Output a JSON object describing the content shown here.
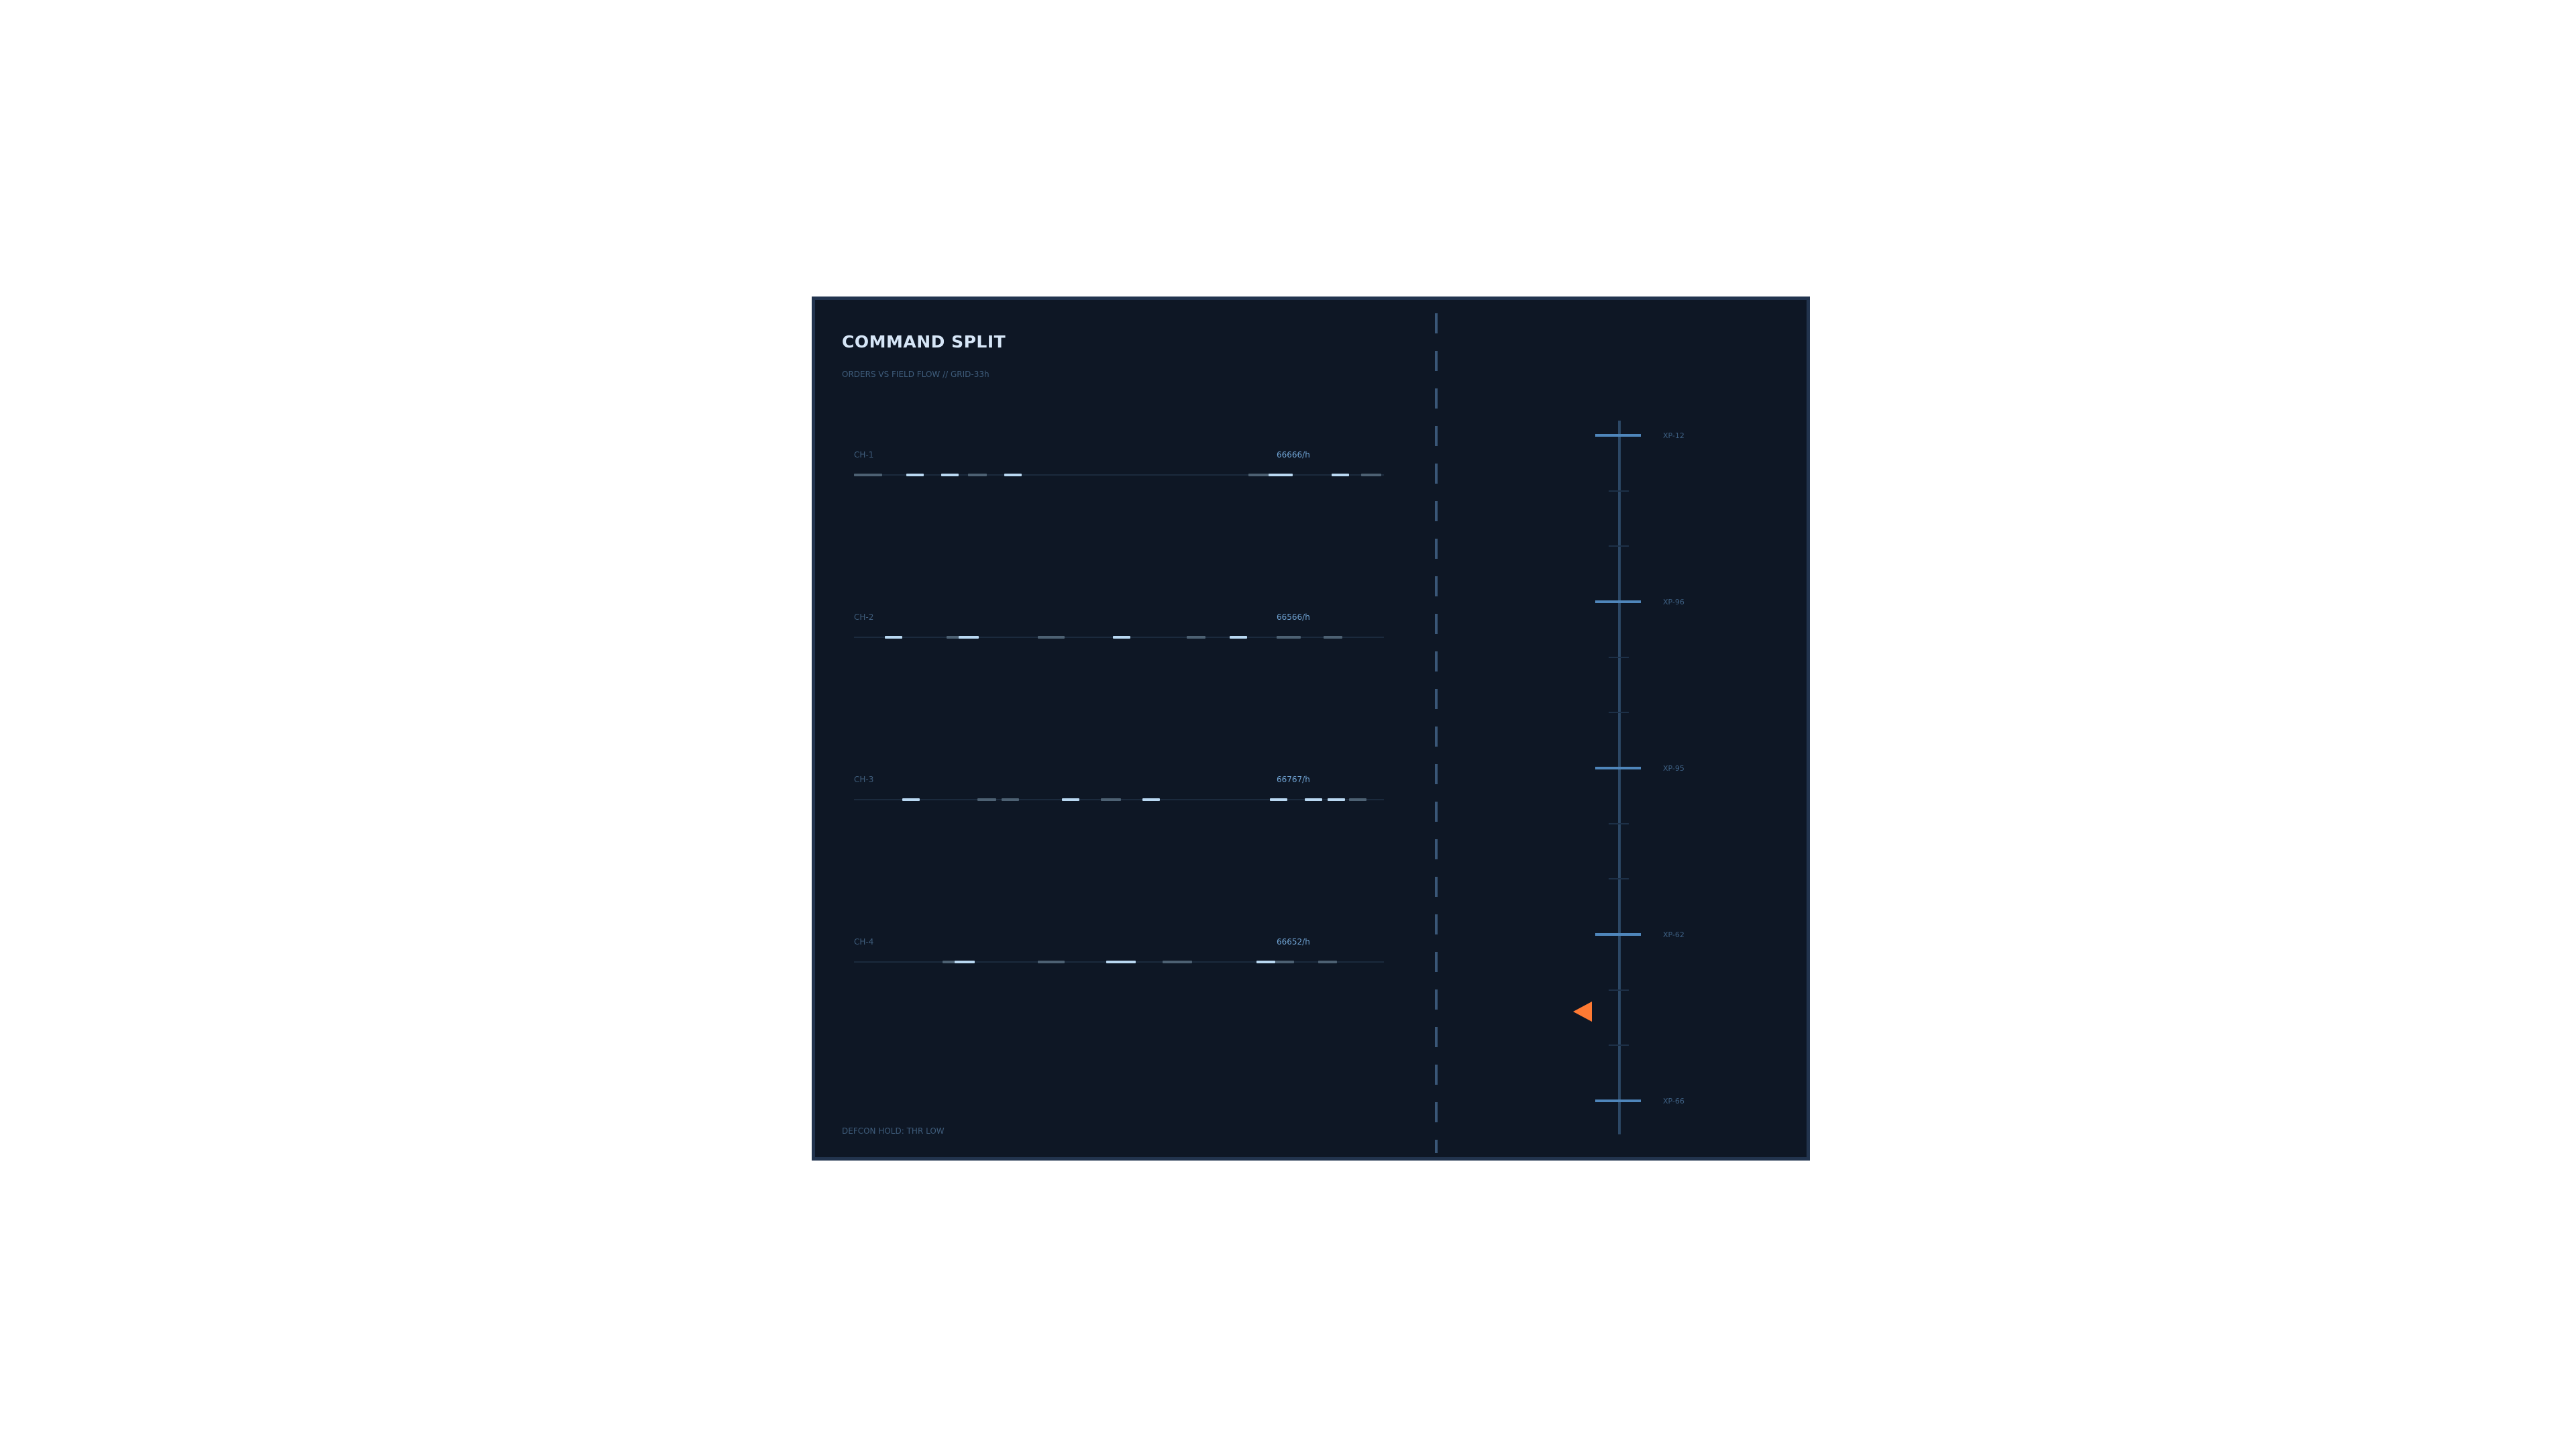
{
  "panel": {
    "title": "COMMAND SPLIT",
    "subtitle": "ORDERS VS FIELD FLOW // GRID-33h",
    "footer": "DEFCON HOLD: THR LOW",
    "accent_color": "#ff7a33",
    "background_color": "#0e1725"
  },
  "channels": [
    {
      "label": "CH-1",
      "rate": "66666/h"
    },
    {
      "label": "CH-2",
      "rate": "66566/h"
    },
    {
      "label": "CH-3",
      "rate": "66767/h"
    },
    {
      "label": "CH-4",
      "rate": "66652/h"
    }
  ],
  "scale": {
    "ticks": [
      "XP-12",
      "XP-96",
      "XP-95",
      "XP-62",
      "XP-66"
    ],
    "marker_icon": "triangle-pointer-icon"
  }
}
